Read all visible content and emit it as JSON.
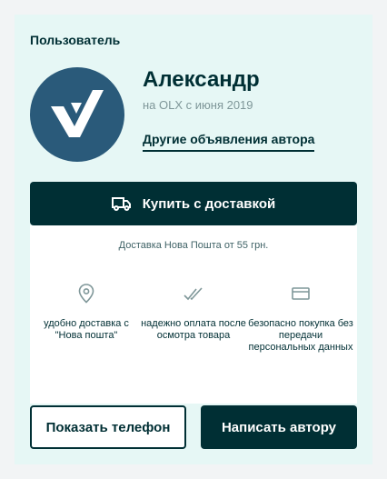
{
  "section_title": "Пользователь",
  "user": {
    "name": "Александр",
    "since": "на OLX с июня 2019",
    "other_ads_link": "Другие объявления автора"
  },
  "buy_button": {
    "label": "Купить с доставкой",
    "icon": "truck-icon"
  },
  "delivery": {
    "price_text": "Доставка Нова Пошта от 55 грн.",
    "features": [
      {
        "icon": "location-pin-icon",
        "text": "удобно доставка с \"Нова пошта\""
      },
      {
        "icon": "double-check-icon",
        "text": "надежно оплата после осмотра товара"
      },
      {
        "icon": "card-icon",
        "text": "безопасно покупка без передачи персональных данных"
      }
    ]
  },
  "actions": {
    "show_phone": "Показать телефон",
    "write_author": "Написать автору"
  },
  "colors": {
    "primary": "#002f34",
    "card_bg": "#e6f7f5",
    "avatar_bg": "#2a5a7a",
    "muted_text": "#7f9799"
  }
}
